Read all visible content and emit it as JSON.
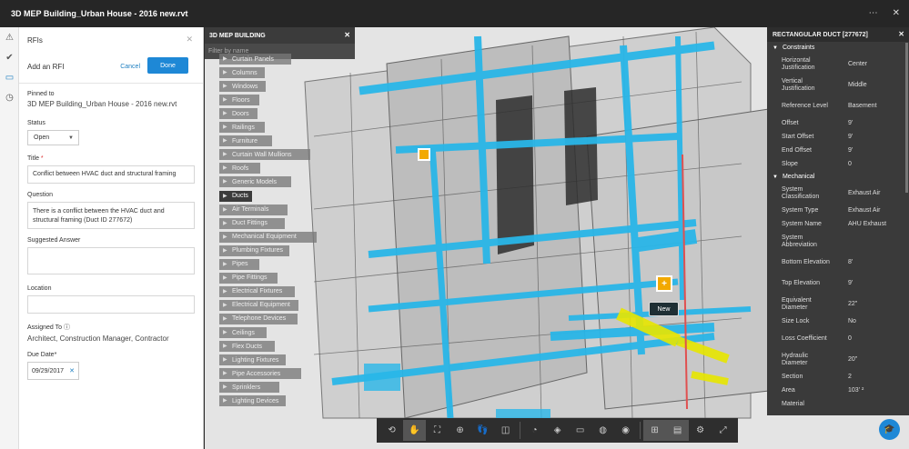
{
  "window": {
    "title": "3D MEP Building_Urban House - 2016 new.rvt",
    "more_glyph": "⋯",
    "close_glyph": "✕"
  },
  "rail": [
    {
      "icon": "warning-icon",
      "glyph": "⚠"
    },
    {
      "icon": "checklist-icon",
      "glyph": "✔"
    },
    {
      "icon": "rfi-icon",
      "glyph": "▭"
    },
    {
      "icon": "clock-icon",
      "glyph": "◷"
    }
  ],
  "rfi": {
    "heading": "RFIs",
    "close_glyph": "✕",
    "add_title": "Add an RFI",
    "cancel_label": "Cancel",
    "done_label": "Done",
    "pinned_label": "Pinned to",
    "pinned_value": "3D MEP Building_Urban House - 2016 new.rvt",
    "status_label": "Status",
    "status_value": "Open",
    "title_label": "Title",
    "title_required": "*",
    "title_value": "Conflict between HVAC duct and structural framing",
    "question_label": "Question",
    "question_value": "There is a conflict between the HVAC duct and structural framing (Duct ID 277672)",
    "suggested_label": "Suggested Answer",
    "suggested_value": "",
    "location_label": "Location",
    "location_value": "",
    "assigned_label": "Assigned To",
    "assigned_info_glyph": "ⓘ",
    "assigned_value": "Architect, Construction Manager, Contractor",
    "due_label": "Due Date*",
    "due_value": "09/29/2017",
    "due_clear_glyph": "✕"
  },
  "browser": {
    "title": "3D MEP BUILDING",
    "close_glyph": "✕",
    "filter_placeholder": "Filter by name",
    "items": [
      "Curtain Panels",
      "Columns",
      "Windows",
      "Floors",
      "Doors",
      "Railings",
      "Furniture",
      "Curtain Wall Mullions",
      "Roofs",
      "Generic Models",
      "Ducts",
      "Air Terminals",
      "Duct Fittings",
      "Mechanical Equipment",
      "Plumbing Fixtures",
      "Pipes",
      "Pipe Fittings",
      "Electrical Fixtures",
      "Electrical Equipment",
      "Telephone Devices",
      "Ceilings",
      "Flex Ducts",
      "Lighting Fixtures",
      "Pipe Accessories",
      "Sprinklers",
      "Lighting Devices"
    ],
    "active_item": "Ducts"
  },
  "properties": {
    "title": "RECTANGULAR DUCT [277672]",
    "close_glyph": "✕",
    "constraints_label": "Constraints",
    "constraints": [
      {
        "k": "Horizontal Justification",
        "v": "Center"
      },
      {
        "k": "Vertical Justification",
        "v": "Middle"
      },
      {
        "k": "Reference Level",
        "v": "Basement"
      },
      {
        "k": "Offset",
        "v": "9'"
      },
      {
        "k": "Start Offset",
        "v": "9'"
      },
      {
        "k": "End Offset",
        "v": "9'"
      },
      {
        "k": "Slope",
        "v": "0"
      }
    ],
    "mechanical_label": "Mechanical",
    "mechanical": [
      {
        "k": "System Classification",
        "v": "Exhaust Air"
      },
      {
        "k": "System Type",
        "v": "Exhaust Air"
      },
      {
        "k": "System Name",
        "v": "AHU Exhaust"
      },
      {
        "k": "System Abbreviation",
        "v": ""
      },
      {
        "k": "Bottom Elevation",
        "v": "8'"
      },
      {
        "k": "Top Elevation",
        "v": "9'"
      },
      {
        "k": "Equivalent Diameter",
        "v": "22\""
      },
      {
        "k": "Size Lock",
        "v": "No"
      },
      {
        "k": "Loss Coefficient",
        "v": "0"
      },
      {
        "k": "Hydraulic Diameter",
        "v": "20\""
      },
      {
        "k": "Section",
        "v": "2"
      },
      {
        "k": "Area",
        "v": "103' ²"
      },
      {
        "k": "Material",
        "v": ""
      }
    ]
  },
  "viewport": {
    "new_label": "New",
    "plus_glyph": "+"
  },
  "toolbar": [
    {
      "name": "orbit-icon",
      "glyph": "⟲"
    },
    {
      "name": "pan-icon",
      "glyph": "✋",
      "active": true
    },
    {
      "name": "fit-to-view-icon",
      "glyph": "⛶"
    },
    {
      "name": "zoom-icon",
      "glyph": "⊕"
    },
    {
      "name": "first-person-icon",
      "glyph": "👣"
    },
    {
      "name": "section-icon",
      "glyph": "◫"
    },
    {
      "name": "measure-icon",
      "glyph": "◔"
    },
    {
      "name": "explode-icon",
      "glyph": "◈"
    },
    {
      "name": "section-plane-icon",
      "glyph": "▭"
    },
    {
      "name": "hide-icon",
      "glyph": "◍"
    },
    {
      "name": "show-icon",
      "glyph": "◉"
    },
    {
      "name": "model-browser-icon",
      "glyph": "⊞",
      "active": true
    },
    {
      "name": "properties-icon",
      "glyph": "▤",
      "active": true
    },
    {
      "name": "settings-icon",
      "glyph": "⚙"
    },
    {
      "name": "fullscreen-icon",
      "glyph": "⤢"
    }
  ],
  "help": {
    "glyph": "🎓"
  },
  "colors": {
    "accent": "#1e88d6",
    "duct": "#29b6e8",
    "duct_selected": "#e8e600",
    "pin": "#f2a900"
  }
}
